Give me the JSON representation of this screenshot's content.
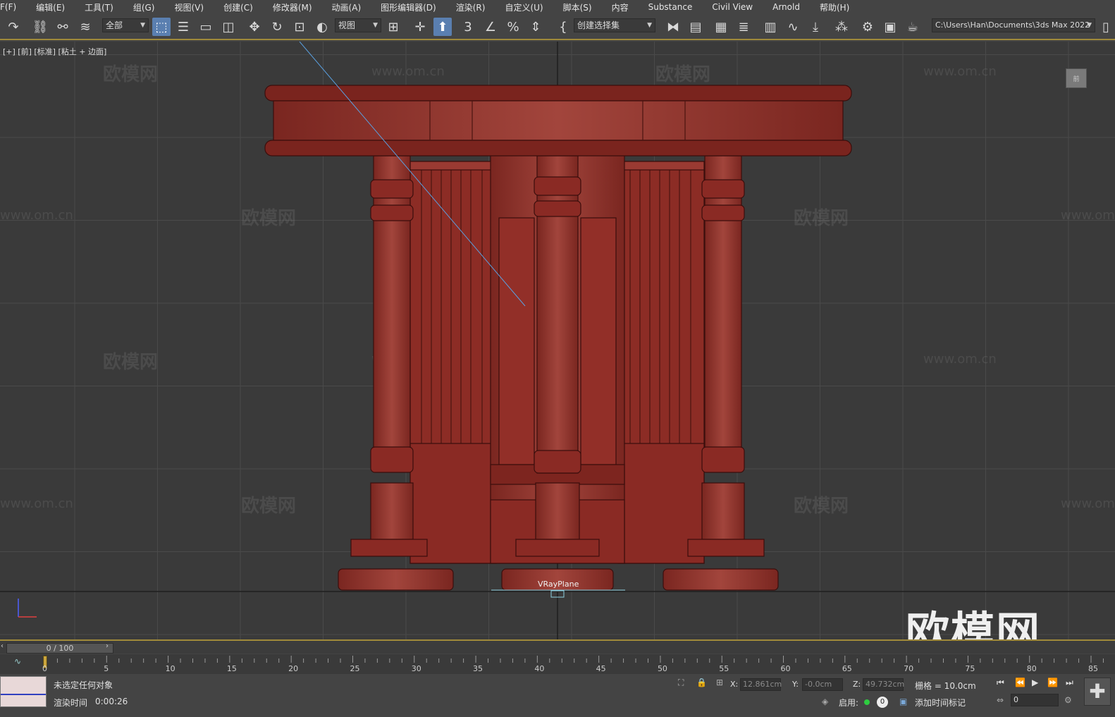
{
  "menu": [
    "F(F)",
    "编辑(E)",
    "工具(T)",
    "组(G)",
    "视图(V)",
    "创建(C)",
    "修改器(M)",
    "动画(A)",
    "图形编辑器(D)",
    "渲染(R)",
    "自定义(U)",
    "脚本(S)",
    "内容",
    "Substance",
    "Civil View",
    "Arnold",
    "帮助(H)"
  ],
  "toolbar": {
    "filter_value": "全部",
    "refcoord_value": "视图",
    "selection_set_placeholder": "创建选择集",
    "path": "C:\\Users\\Han\\Documents\\3ds Max 2022"
  },
  "viewport": {
    "label": "[+] [前] [标准] [粘土 + 边面]",
    "object_label": "VRayPlane",
    "viewcube_label": "前"
  },
  "watermark": {
    "text": "欧模网",
    "url": "www.om.cn"
  },
  "timeline": {
    "frame": "0 / 100",
    "ticks": [
      "0",
      "5",
      "10",
      "15",
      "20",
      "25",
      "30",
      "35",
      "40",
      "45",
      "50",
      "55",
      "60",
      "65",
      "70",
      "75",
      "80",
      "85"
    ]
  },
  "status": {
    "selection": "未选定任何对象",
    "render_label": "渲染时间",
    "render_time": "0:00:26",
    "x_label": "X:",
    "x": "12.861cm",
    "y_label": "Y:",
    "y": "-0.0cm",
    "z_label": "Z:",
    "z": "49.732cm",
    "grid": "栅格 = 10.0cm",
    "enable_label": "启用:",
    "enable_value": "0",
    "add_time_tag": "添加时间标记",
    "frame_value": "0"
  },
  "colors": {
    "wood": "#8c2c25",
    "wood_light": "#a84a42",
    "wire": "#3a0e0c",
    "timeline_accent": "#a08a3a",
    "active_tool": "#5a7fb0"
  }
}
